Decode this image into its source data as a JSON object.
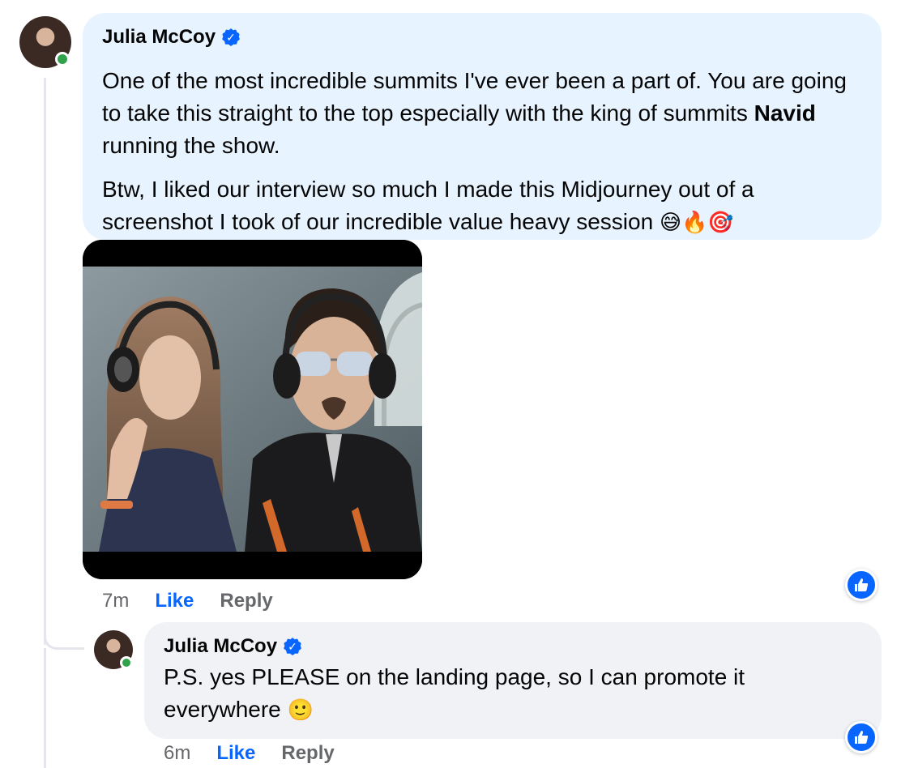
{
  "comment1": {
    "author": "Julia McCoy",
    "paragraph1_before": "One of the most incredible summits I've ever been a part of. You are going to take this straight to the top especially with the king of summits ",
    "paragraph1_bold": "Navid",
    "paragraph1_after": " running the show.",
    "paragraph2": "Btw, I liked our interview so much I made this Midjourney out of a screenshot I took of our incredible value heavy session",
    "paragraph2_emojis": "😅🔥🎯",
    "time": "7m",
    "like_label": "Like",
    "reply_label": "Reply"
  },
  "comment2": {
    "author": "Julia McCoy",
    "text": "P.S. yes PLEASE on the landing page, so I can promote it everywhere",
    "emoji": "🙂",
    "time": "6m",
    "like_label": "Like",
    "reply_label": "Reply"
  },
  "icons": {
    "verified": "verified-badge-icon",
    "reaction": "thumbs-up-icon",
    "online": "online-status-icon"
  },
  "colors": {
    "primary_bubble": "#e7f3ff",
    "secondary_bubble": "#f0f2f5",
    "accent": "#0866ff",
    "online": "#31a24c",
    "meta_text": "#65676b"
  }
}
